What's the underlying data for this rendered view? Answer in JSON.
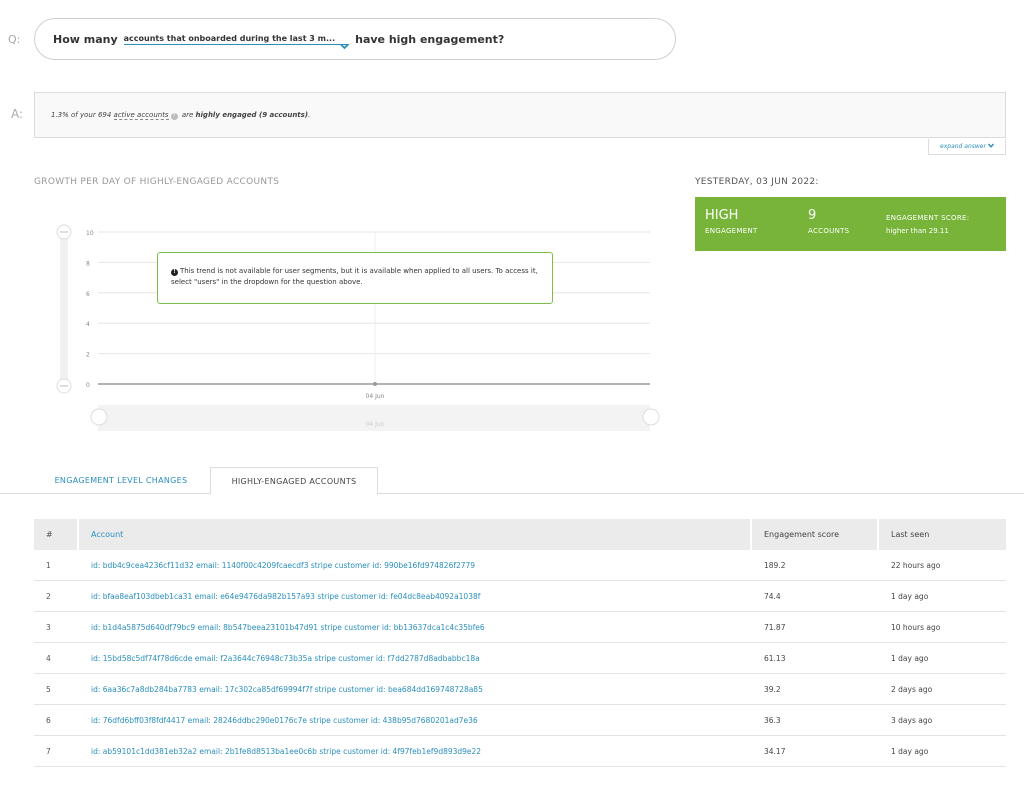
{
  "question": {
    "marker": "Q:",
    "prefix": "How many",
    "select_value": "accounts that onboarded during the last 3 m...",
    "suffix": "have high engagement?"
  },
  "answer": {
    "marker": "A:",
    "text_before": "1.3% of your 694",
    "link_text": "active  accounts",
    "text_middle": "are",
    "bold_text": "highly engaged (9 accounts)",
    "text_end": ".",
    "expand_label": "expand answer"
  },
  "chart_heading": "GROWTH PER DAY OF HIGHLY-ENGAGED ACCOUNTS",
  "yesterday_heading": "YESTERDAY, 03 JUN 2022:",
  "summary_card": {
    "level_value": "HIGH",
    "level_label": "ENGAGEMENT",
    "count_value": "9",
    "count_label": "ACCOUNTS",
    "score_label": "ENGAGEMENT SCORE:",
    "score_value": "higher than 29.11",
    "color": "#78b43a"
  },
  "chart_data": {
    "type": "line",
    "x": [
      "04 Jun"
    ],
    "series": [
      {
        "values": [
          0
        ]
      }
    ],
    "yticks": [
      0,
      2,
      4,
      6,
      8,
      10
    ],
    "ylim": [
      0,
      10
    ],
    "navigator_label": "04 Jun",
    "grid": true
  },
  "tooltip": {
    "text": "This trend is not available for user segments, but it is available when applied to all users. To access it, select \"users\" in the dropdown for the question above."
  },
  "tabs": [
    {
      "label": "ENGAGEMENT LEVEL CHANGES",
      "active": false
    },
    {
      "label": "HIGHLY-ENGAGED ACCOUNTS",
      "active": true
    }
  ],
  "table": {
    "headers": [
      "#",
      "Account",
      "Engagement score",
      "Last seen"
    ],
    "rows": [
      {
        "num": "1",
        "account": "id: bdb4c9cea4236cf11d32 email: 1140f00c4209fcaecdf3 stripe customer id: 990be16fd974826f2779",
        "score": "189.2",
        "seen": "22 hours ago"
      },
      {
        "num": "2",
        "account": "id: bfaa8eaf103dbeb1ca31 email: e64e9476da982b157a93 stripe customer id: fe04dc8eab4092a1038f",
        "score": "74.4",
        "seen": "1 day ago"
      },
      {
        "num": "3",
        "account": "id: b1d4a5875d640df79bc9 email: 8b547beea23101b47d91 stripe customer id: bb13637dca1c4c35bfe6",
        "score": "71.87",
        "seen": "10 hours ago"
      },
      {
        "num": "4",
        "account": "id: 15bd58c5df74f78d6cde email: f2a3644c76948c73b35a stripe customer id: f7dd2787d8adbabbc18a",
        "score": "61.13",
        "seen": "1 day ago"
      },
      {
        "num": "5",
        "account": "id: 6aa36c7a8db284ba7783 email: 17c302ca85df69994f7f stripe customer id: bea684dd169748728a85",
        "score": "39.2",
        "seen": "2 days ago"
      },
      {
        "num": "6",
        "account": "id: 76dfd6bff03f8fdf4417 email: 28246ddbc290e0176c7e stripe customer id: 438b95d7680201ad7e36",
        "score": "36.3",
        "seen": "3 days ago"
      },
      {
        "num": "7",
        "account": "id: ab59101c1dd381eb32a2 email: 2b1fe8d8513ba1ee0c6b stripe customer id: 4f97feb1ef9d893d9e22",
        "score": "34.17",
        "seen": "1 day ago"
      }
    ]
  }
}
